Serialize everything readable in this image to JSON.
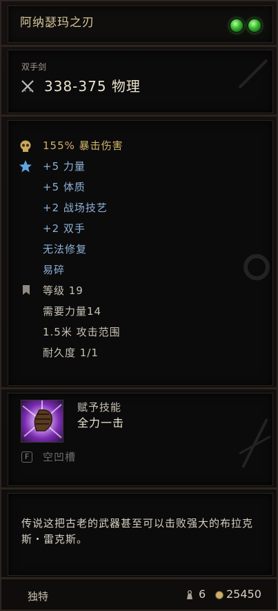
{
  "item": {
    "name": "阿纳瑟玛之刃",
    "weapon_type": "双手剑",
    "damage": "338-375 物理"
  },
  "stats": {
    "crit": "155% 暴击伤害",
    "bonuses": [
      "+5 力量",
      "+5 体质",
      "+2 战场技艺",
      "+2 双手"
    ],
    "unrepairable": "无法修复",
    "fragile": "易碎",
    "level": "等级 19",
    "requirement": "需要力量14",
    "range": "1.5米 攻击范围",
    "durability": "耐久度 1/1"
  },
  "skill": {
    "label": "赋予技能",
    "name": "全力一击"
  },
  "slot": {
    "label": "空凹槽"
  },
  "description": "传说这把古老的武器甚至可以击败强大的布拉克斯・雷克斯。",
  "footer": {
    "rarity": "独特",
    "weight": "6",
    "value": "25450"
  },
  "colors": {
    "title": "#d7c59a",
    "bonus_blue": "#8fb2d6",
    "crit_gold": "#d2b36a"
  },
  "icons": {
    "gems": [
      "green-gem-icon",
      "green-gem-icon"
    ],
    "damage": "crossed-swords-icon",
    "crit": "skull-icon",
    "bonus": "star-icon",
    "level": "bookmark-icon",
    "slot": "rune-slot-icon",
    "weight": "weight-icon",
    "gold": "coin-icon"
  }
}
